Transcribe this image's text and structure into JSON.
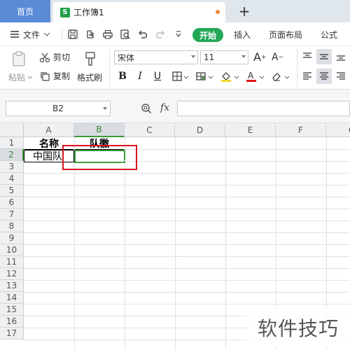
{
  "tabs": {
    "home": "首页",
    "doc_icon": "S",
    "doc_title": "工作簿1",
    "new_tab": "+"
  },
  "menubar": {
    "menu_label": "文件",
    "start": "开始",
    "insert": "插入",
    "page_layout": "页面布局",
    "formula": "公式"
  },
  "ribbon": {
    "paste": "粘贴",
    "cut": "剪切",
    "copy": "复制",
    "format_painter": "格式刷",
    "font_name": "宋体",
    "font_size": "11",
    "grow_font": "A",
    "shrink_font": "A",
    "bold": "B",
    "italic": "I",
    "underline": "U"
  },
  "formula_bar": {
    "cell_ref": "B2",
    "fx": "fx",
    "content": ""
  },
  "sheet": {
    "columns": [
      "A",
      "B",
      "C",
      "D",
      "E",
      "F",
      "G"
    ],
    "selected_column": "B",
    "rows": [
      "1",
      "2",
      "3",
      "4",
      "5",
      "6",
      "7",
      "8",
      "9",
      "10",
      "11",
      "12",
      "13",
      "14",
      "15",
      "16",
      "17"
    ],
    "selected_row": "2",
    "cells": {
      "A1": "名称",
      "B1": "队徽",
      "A2": "中国队",
      "B2": ""
    }
  },
  "colors": {
    "accent_green": "#23a856",
    "selection_green": "#3c9a3c",
    "highlight_red": "#d9141c",
    "home_tab_blue": "#5b8ad6"
  },
  "watermark": "软件技巧"
}
